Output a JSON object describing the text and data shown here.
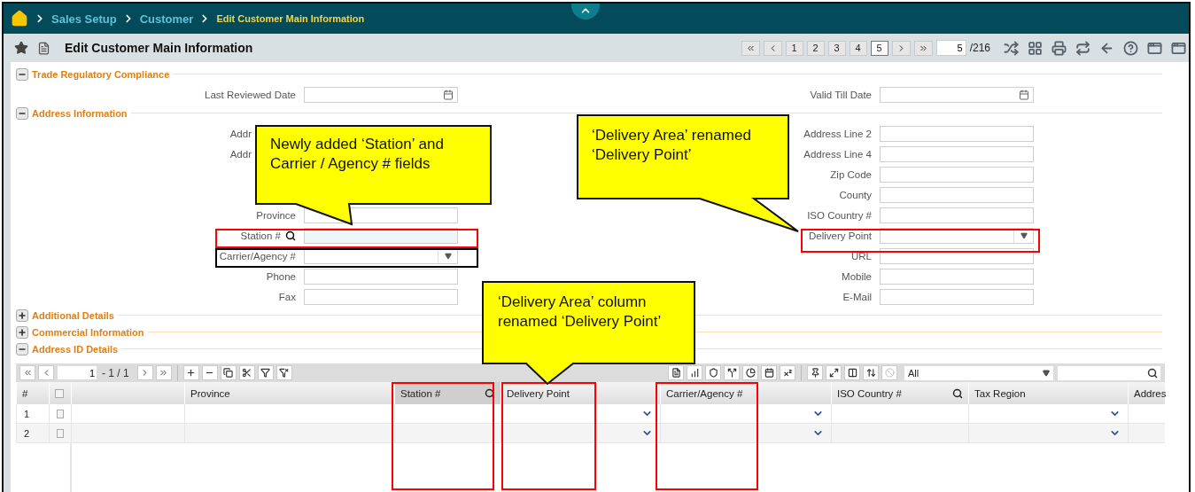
{
  "breadcrumb": [
    {
      "label": "Sales Setup",
      "current": false
    },
    {
      "label": "Customer",
      "current": false
    },
    {
      "label": "Edit Customer Main Information",
      "current": true
    }
  ],
  "page_title": "Edit Customer Main Information",
  "pager": {
    "pages": [
      {
        "label": "1",
        "selected": false
      },
      {
        "label": "2",
        "selected": false
      },
      {
        "label": "3",
        "selected": false
      },
      {
        "label": "4",
        "selected": false
      },
      {
        "label": "5",
        "selected": true
      }
    ],
    "current": "5",
    "total": "/216"
  },
  "sections": [
    {
      "title": "Trade Regulatory Compliance",
      "expanded": true,
      "left_fields": [
        {
          "label": "Last Reviewed Date",
          "kind": "date"
        }
      ],
      "right_fields": [
        {
          "label": "Valid Till Date",
          "kind": "date"
        }
      ]
    },
    {
      "title": "Address Information",
      "expanded": true,
      "left_fields": [
        {
          "label": "Addr",
          "kind": "label_only"
        },
        {
          "label": "Addr",
          "kind": "label_only"
        },
        {
          "label": "Province",
          "kind": "text"
        },
        {
          "label": "Station #",
          "kind": "lookup"
        },
        {
          "label": "Carrier/Agency #",
          "kind": "dropdown"
        },
        {
          "label": "Phone",
          "kind": "text"
        },
        {
          "label": "Fax",
          "kind": "text"
        }
      ],
      "right_fields": [
        {
          "label": "Address Line 2",
          "kind": "text"
        },
        {
          "label": "Address Line 4",
          "kind": "text"
        },
        {
          "label": "Zip Code",
          "kind": "text"
        },
        {
          "label": "County",
          "kind": "text"
        },
        {
          "label": "ISO Country #",
          "kind": "text"
        },
        {
          "label": "Delivery Point",
          "kind": "dropdown"
        },
        {
          "label": "URL",
          "kind": "text"
        },
        {
          "label": "Mobile",
          "kind": "text"
        },
        {
          "label": "E-Mail",
          "kind": "text"
        }
      ]
    },
    {
      "title": "Additional Details",
      "expanded": false
    },
    {
      "title": "Commercial Information",
      "expanded": false
    },
    {
      "title": "Address ID Details",
      "expanded": true,
      "grid": {
        "select_all_checked": false,
        "pager_value": "1",
        "pager_range": "- 1 / 1",
        "view_filter": "All",
        "columns": [
          {
            "label": "#",
            "kind": "number"
          },
          {
            "kind": "check"
          },
          {
            "kind": "blank"
          },
          {
            "label": "Province",
            "kind": "text"
          },
          {
            "label": "Station #",
            "kind": "lookup"
          },
          {
            "label": "Delivery Point",
            "kind": "dropdown"
          },
          {
            "label": "Carrier/Agency #",
            "kind": "dropdown"
          },
          {
            "label": "ISO Country #",
            "kind": "search"
          },
          {
            "label": "Tax Region",
            "kind": "dropdown"
          },
          {
            "label": "Addres",
            "kind": "text"
          }
        ],
        "rows": [
          {
            "number": "1",
            "checked": false
          },
          {
            "number": "2",
            "checked": false
          }
        ]
      }
    }
  ],
  "annotations": {
    "callouts": [
      {
        "text": "Newly added ‘Station’ and Carrier / Agency # fields"
      },
      {
        "text": "‘Delivery Area’ renamed ‘Delivery Point’"
      },
      {
        "text": "‘Delivery Area’ column renamed ‘Delivery Point’"
      }
    ],
    "frames": [
      {
        "color": "#ff0000"
      },
      {
        "color": "#000000"
      },
      {
        "color": "#ff0000"
      },
      {
        "color": "#ff0000"
      },
      {
        "color": "#ff0000"
      },
      {
        "color": "#ff0000"
      }
    ]
  }
}
